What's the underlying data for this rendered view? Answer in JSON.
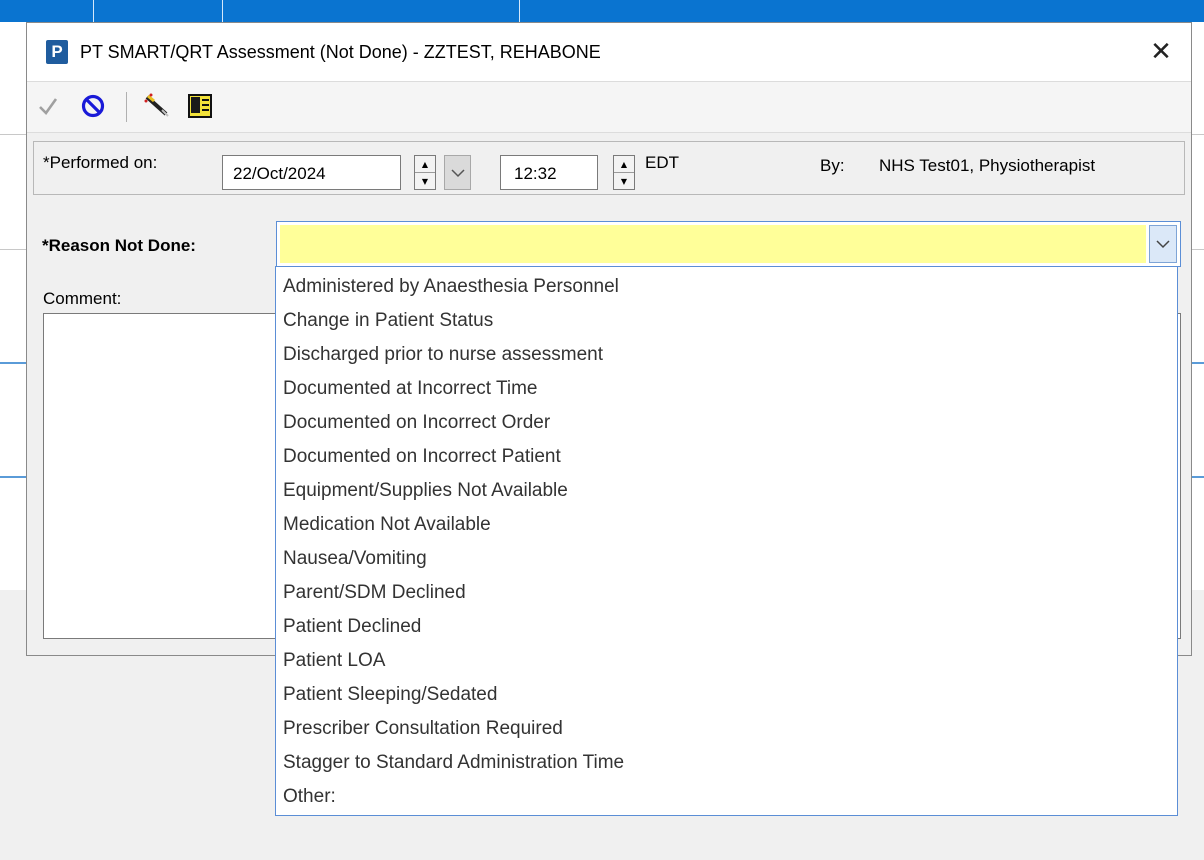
{
  "dialog": {
    "app_icon_letter": "P",
    "title": "PT SMART/QRT Assessment (Not Done) - ZZTEST, REHABONE",
    "close_glyph": "✕"
  },
  "toolbar": {
    "buttons": [
      {
        "name": "sign-checkmark-icon"
      },
      {
        "name": "cancel-icon"
      },
      {
        "name": "pen-edit-icon"
      },
      {
        "name": "document-notes-icon"
      }
    ]
  },
  "performed": {
    "label": "*Performed on:",
    "date_value": "22/Oct/2024",
    "time_value": "12:32",
    "timezone": "EDT",
    "by_label": "By:",
    "by_value": "NHS Test01, Physiotherapist"
  },
  "reason": {
    "label": "*Reason Not Done:",
    "value": "",
    "field_color": "#ffff99",
    "options": [
      "Administered by Anaesthesia Personnel",
      "Change in Patient Status",
      "Discharged prior to nurse assessment",
      "Documented at Incorrect Time",
      "Documented on Incorrect Order",
      "Documented on Incorrect Patient",
      "Equipment/Supplies Not Available",
      "Medication Not Available",
      "Nausea/Vomiting",
      "Parent/SDM Declined",
      "Patient Declined",
      "Patient LOA",
      "Patient Sleeping/Sedated",
      "Prescriber Consultation Required",
      "Stagger to Standard Administration Time",
      "Other:"
    ]
  },
  "comment": {
    "label": "Comment:",
    "value": ""
  },
  "colors": {
    "accent_blue": "#0a74d0",
    "highlight_yellow": "#ffff99"
  }
}
